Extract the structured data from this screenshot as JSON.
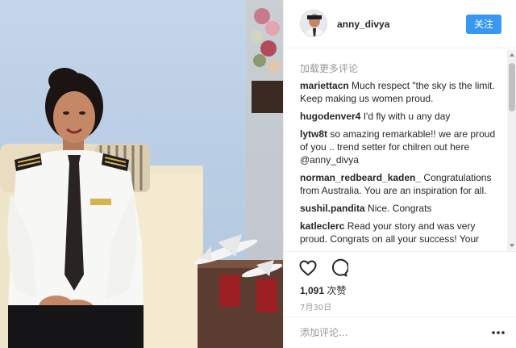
{
  "photo": {
    "alt_icon": "photo-pilot-in-uniform"
  },
  "header": {
    "username": "anny_divya",
    "follow_label": "关注",
    "accent_color": "#3897f0"
  },
  "comments": {
    "load_more": "加载更多评论",
    "items": [
      {
        "user": "mariettacn",
        "text": "Much respect \"the sky is the limit. Keep making us women proud."
      },
      {
        "user": "hugodenver4",
        "text": "I'd fly with u any day"
      },
      {
        "user": "lytw8t",
        "text": "so amazing remarkable!! we are proud of you .. trend setter for chilren out here @anny_divya"
      },
      {
        "user": "norman_redbeard_kaden_",
        "text": "Congratulations from Australia. You are an inspiration for all."
      },
      {
        "user": "sushil.pandita",
        "text": "Nice. Congrats"
      },
      {
        "user": "katleclerc",
        "text": "Read your story and was very proud. Congrats on all your success! Your"
      }
    ]
  },
  "actions": {
    "like_icon": "heart-icon",
    "comment_icon": "comment-icon",
    "likes_count": "1,091",
    "likes_suffix": "次赞",
    "date": "7月30日"
  },
  "add_comment": {
    "placeholder": "添加评论...",
    "more_icon": "more-options-icon"
  }
}
